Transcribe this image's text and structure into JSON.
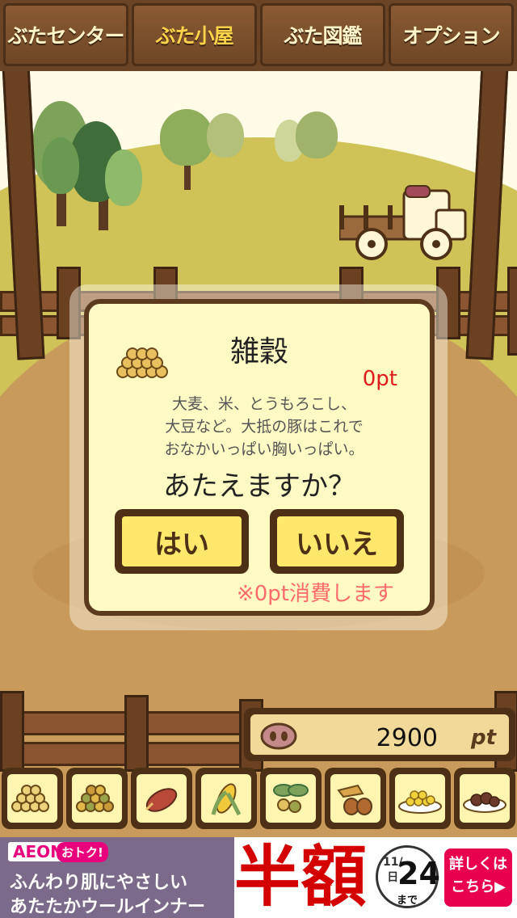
{
  "nav": {
    "tabs": [
      {
        "label": "ぶたセンター"
      },
      {
        "label": "ぶた小屋"
      },
      {
        "label": "ぶた図鑑"
      },
      {
        "label": "オプション"
      }
    ],
    "active_index": 1
  },
  "dialog": {
    "title": "雑穀",
    "cost": "0pt",
    "description_lines": [
      "大麦、米、とうもろこし、",
      "大豆など。大抵の豚はこれで",
      "おなかいっぱい胸いっぱい。"
    ],
    "question": "あたえますか？",
    "yes_label": "はい",
    "no_label": "いいえ",
    "note": "※0pt消費します",
    "icon": "grain-pile-icon"
  },
  "points": {
    "value": "2900",
    "unit": "pt",
    "icon": "pig-nose-icon"
  },
  "feed_items": [
    {
      "icon": "grain-pile-icon"
    },
    {
      "icon": "mixed-grain-icon"
    },
    {
      "icon": "sweet-potato-icon"
    },
    {
      "icon": "corn-icon"
    },
    {
      "icon": "beans-leaves-icon"
    },
    {
      "icon": "acorn-icon"
    },
    {
      "icon": "corn-plate-icon"
    },
    {
      "icon": "meatball-plate-icon"
    }
  ],
  "ad": {
    "brand": "AEON",
    "tag": "おトク!",
    "line1": "ふんわり肌にやさしい",
    "line2": "あたたかウールインナー",
    "headline": "半額",
    "date_month": "11/",
    "date_weekday": "日",
    "date_day": "24",
    "date_suffix": "まで",
    "cta": "詳しくは こちら▶"
  },
  "colors": {
    "wood_dark": "#4d3015",
    "dialog_bg": "#fff9c4",
    "button_yellow": "#ffe86b",
    "cost_red": "#e01b1b",
    "note_pink": "#ff6b6b",
    "nav_text": "#fff4c9",
    "nav_active_text": "#ffd34a"
  }
}
